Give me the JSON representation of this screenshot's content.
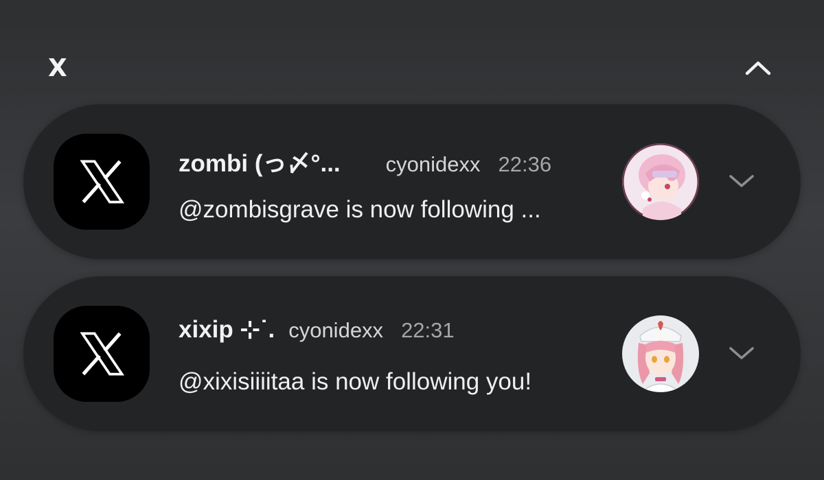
{
  "group": {
    "app_label": "X",
    "collapse_icon": "chevron-up-icon"
  },
  "notifications": [
    {
      "app_icon": "x-logo-icon",
      "sender": "zombi (っ〆°...",
      "account": "cyonidexx",
      "time": "22:36",
      "message": "@zombisgrave is now following ...",
      "avatar": "anime-avatar-pink-hair",
      "expand_icon": "chevron-down-icon"
    },
    {
      "app_icon": "x-logo-icon",
      "sender": "xixip ⊹˙.",
      "account": "cyonidexx",
      "time": "22:31",
      "message": "@xixisiiiitaa is now following you!",
      "avatar": "anime-avatar-nurse-pink-hair",
      "expand_icon": "chevron-down-icon"
    }
  ],
  "colors": {
    "card_background": "#232426",
    "time_text": "#a7a7a9"
  }
}
